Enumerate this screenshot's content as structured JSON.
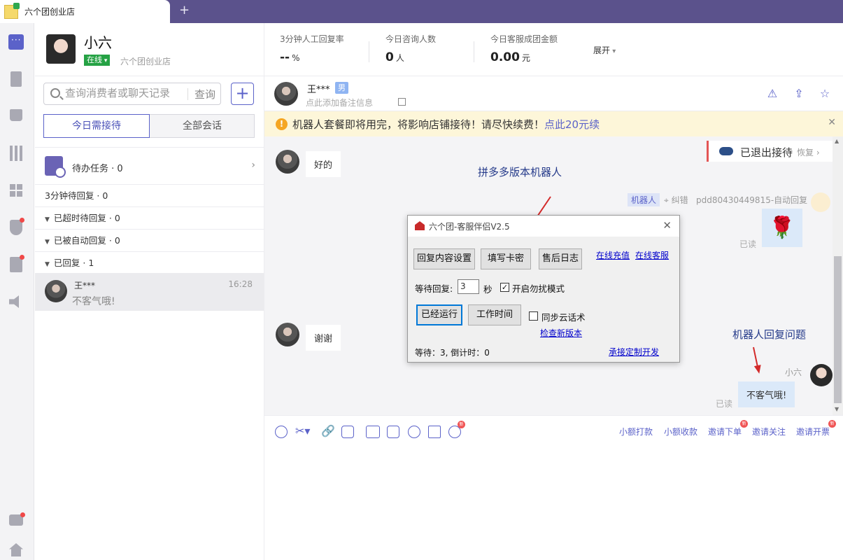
{
  "window": {
    "tab_title": "六个团创业店",
    "new_tab": "+"
  },
  "profile": {
    "name": "小六",
    "status": "在线",
    "shop": "六个团创业店"
  },
  "stats": [
    {
      "label": "3分钟人工回复率",
      "value": "--",
      "unit": "%"
    },
    {
      "label": "今日咨询人数",
      "value": "0",
      "unit": "人"
    },
    {
      "label": "今日客服成团金额",
      "value": "0.00",
      "unit": "元"
    }
  ],
  "expand_label": "展开",
  "search": {
    "placeholder": "查询消费者或聊天记录",
    "button": "查询"
  },
  "conv_tabs": {
    "today": "今日需接待",
    "all": "全部会话"
  },
  "todo": "待办任务 · 0",
  "groups": {
    "wait3": "3分钟待回复 · 0",
    "timeout": "已超时待回复 · 0",
    "auto": "已被自动回复 · 0",
    "replied": "已回复 · 1"
  },
  "conversation": {
    "name": "王***",
    "time": "16:28",
    "last_message": "不客气哦!"
  },
  "chat_header": {
    "name": "王***",
    "gender": "男",
    "note_hint": "点此添加备注信息"
  },
  "banner": {
    "text": "机器人套餐即将用完，将影响店铺接待！请尽快续费！",
    "link": "点此20元续"
  },
  "exit_pill": {
    "text": "已退出接待",
    "restore": "恢复 ›"
  },
  "messages": {
    "m1": "好的",
    "m2": "谢谢",
    "bot_tag": "机器人",
    "bot_fix": "纠错",
    "bot_source": "pdd80430449815-自动回复",
    "read": "已读",
    "self_name": "小六",
    "self_reply": "不客气哦!"
  },
  "annotations": {
    "top": "拼多多版本机器人",
    "bottom": "机器人回复问题"
  },
  "dialog": {
    "title": "六个团-客服伴侣V2.5",
    "btn_reply": "回复内容设置",
    "btn_card": "填写卡密",
    "btn_log": "售后日志",
    "link_recharge": "在线充值",
    "link_service": "在线客服",
    "wait_label": "等待回复:",
    "wait_value": "3",
    "wait_unit": "秒",
    "dnd_label": "开启勿扰模式",
    "btn_running": "已经运行",
    "btn_worktime": "工作时间",
    "sync_label": "同步云话术",
    "link_update": "检查新版本",
    "status": "等待：3, 倒计时：0",
    "link_custom": "承接定制开发"
  },
  "composer_actions": [
    "小额打款",
    "小额收款",
    "邀请下单",
    "邀请关注",
    "邀请开票"
  ],
  "badge_new": "新",
  "colors": {
    "accent": "#5b62c9",
    "titlebar": "#5b528c",
    "online": "#25a244",
    "banner_bg": "#fdf6d9"
  }
}
